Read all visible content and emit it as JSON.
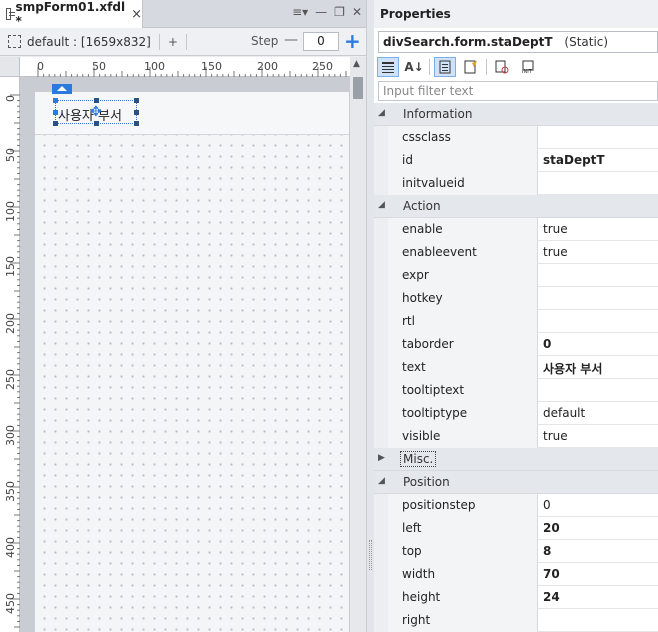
{
  "editor": {
    "tab_title": "smpForm01.xfdl *",
    "tab_close": "×",
    "window_controls": [
      "≡▾",
      "—",
      "❐",
      "✕"
    ],
    "layout_label": "default : [1659x832]",
    "add_layout": "+",
    "step_label": "Step",
    "step_minus": "—",
    "step_value": "0",
    "step_plus": "+",
    "h_ruler_ticks": [
      "0",
      "50",
      "100",
      "150",
      "200",
      "250"
    ],
    "v_ruler_ticks": [
      "0",
      "50",
      "100",
      "150",
      "200",
      "250",
      "300",
      "350",
      "400",
      "450"
    ],
    "component_text": "사용자 부서"
  },
  "properties": {
    "title": "Properties",
    "object_name": "divSearch.form.staDeptT",
    "object_type": "(Static)",
    "filter_placeholder": "Input filter text",
    "toolbar_icons": [
      "category-view-icon",
      "sort-alpha-icon",
      "properties-icon",
      "events-icon",
      "bind-icon",
      "init-icon"
    ],
    "categories": [
      {
        "name": "Information",
        "expanded": true,
        "rows": [
          {
            "name": "cssclass",
            "value": ""
          },
          {
            "name": "id",
            "value": "staDeptT",
            "bold": true
          },
          {
            "name": "initvalueid",
            "value": ""
          }
        ]
      },
      {
        "name": "Action",
        "expanded": true,
        "rows": [
          {
            "name": "enable",
            "value": "true"
          },
          {
            "name": "enableevent",
            "value": "true"
          },
          {
            "name": "expr",
            "value": ""
          },
          {
            "name": "hotkey",
            "value": ""
          },
          {
            "name": "rtl",
            "value": ""
          },
          {
            "name": "taborder",
            "value": "0",
            "bold": true
          },
          {
            "name": "text",
            "value": "사용자 부서",
            "bold": true
          },
          {
            "name": "tooltiptext",
            "value": ""
          },
          {
            "name": "tooltiptype",
            "value": "default"
          },
          {
            "name": "visible",
            "value": "true"
          }
        ]
      },
      {
        "name": "Misc.",
        "expanded": false,
        "focused": true,
        "rows": []
      },
      {
        "name": "Position",
        "expanded": true,
        "rows": [
          {
            "name": "positionstep",
            "value": "0"
          },
          {
            "name": "left",
            "value": "20",
            "bold": true
          },
          {
            "name": "top",
            "value": "8",
            "bold": true
          },
          {
            "name": "width",
            "value": "70",
            "bold": true
          },
          {
            "name": "height",
            "value": "24",
            "bold": true
          },
          {
            "name": "right",
            "value": ""
          }
        ]
      }
    ]
  }
}
